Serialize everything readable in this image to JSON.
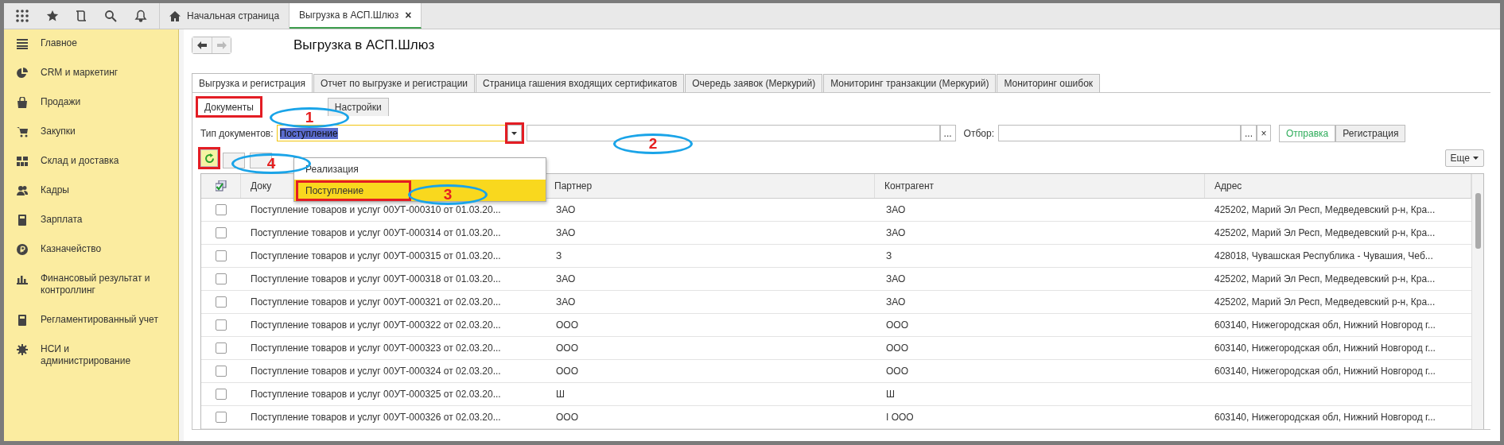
{
  "top_bar": {
    "tabs": [
      {
        "label": "Начальная страница",
        "selected": false
      },
      {
        "label": "Выгрузка в АСП.Шлюз",
        "selected": true,
        "close": "×"
      }
    ]
  },
  "sidebar": {
    "items": [
      {
        "label": "Главное"
      },
      {
        "label": "CRM и маркетинг"
      },
      {
        "label": "Продажи"
      },
      {
        "label": "Закупки"
      },
      {
        "label": "Склад и доставка"
      },
      {
        "label": "Кадры"
      },
      {
        "label": "Зарплата"
      },
      {
        "label": "Казначейство"
      },
      {
        "label": "Финансовый результат и контроллинг"
      },
      {
        "label": "Регламентированный учет"
      },
      {
        "label": "НСИ и администрирование"
      }
    ]
  },
  "page": {
    "title": "Выгрузка в АСП.Шлюз"
  },
  "tabs": [
    {
      "label": "Выгрузка и регистрация",
      "selected": true
    },
    {
      "label": "Отчет по выгрузке и регистрации",
      "selected": false
    },
    {
      "label": "Страница гашения входящих сертификатов",
      "selected": false
    },
    {
      "label": "Очередь заявок (Меркурий)",
      "selected": false
    },
    {
      "label": "Мониторинг транзакции (Меркурий)",
      "selected": false
    },
    {
      "label": "Мониторинг ошибок",
      "selected": false
    }
  ],
  "subtabs": [
    {
      "label": "Документы",
      "selected": true,
      "highlighted": true
    },
    {
      "label": "Настройки",
      "selected": false,
      "highlighted": false
    }
  ],
  "filter": {
    "label": "Тип документов:",
    "value": "Поступление",
    "arrow_highlighted": true,
    "select_button": "...",
    "filter_label": "Отбор:",
    "filter_select": "...",
    "filter_clear": "×"
  },
  "mode_buttons": [
    {
      "label": "Отправка",
      "selected": true
    },
    {
      "label": "Регистрация",
      "selected": false
    }
  ],
  "toolbar": {
    "refresh_highlighted": true,
    "more": "Еще"
  },
  "dropdown": {
    "options": [
      {
        "label": "Реализация",
        "selected": false,
        "highlighted": false
      },
      {
        "label": "Поступление",
        "selected": true,
        "highlighted": true
      }
    ]
  },
  "table": {
    "columns": [
      "Доку",
      "Партнер",
      "Контрагент",
      "Адрес"
    ],
    "rows": [
      {
        "checked": false,
        "document": "Поступление товаров и услуг 00УТ-000310 от 01.03.20...",
        "partner": "ЗАО",
        "counterparty": "ЗАО",
        "address": "425202, Марий Эл Респ, Медведевский р-н, Кра..."
      },
      {
        "checked": false,
        "document": "Поступление товаров и услуг 00УТ-000314 от 01.03.20...",
        "partner": "ЗАО",
        "counterparty": "ЗАО",
        "address": "425202, Марий Эл Респ, Медведевский р-н, Кра..."
      },
      {
        "checked": false,
        "document": "Поступление товаров и услуг 00УТ-000315 от 01.03.20...",
        "partner": "З",
        "counterparty": "З",
        "address": "428018, Чувашская Республика - Чувашия, Чеб..."
      },
      {
        "checked": false,
        "document": "Поступление товаров и услуг 00УТ-000318 от 01.03.20...",
        "partner": "ЗАО",
        "counterparty": "ЗАО",
        "address": "425202, Марий Эл Респ, Медведевский р-н, Кра..."
      },
      {
        "checked": false,
        "document": "Поступление товаров и услуг 00УТ-000321 от 02.03.20...",
        "partner": "ЗАО",
        "counterparty": "ЗАО",
        "address": "425202, Марий Эл Респ, Медведевский р-н, Кра..."
      },
      {
        "checked": false,
        "document": "Поступление товаров и услуг 00УТ-000322 от 02.03.20...",
        "partner": "ООО",
        "counterparty": "ООО",
        "address": "603140, Нижегородская обл, Нижний Новгород г..."
      },
      {
        "checked": false,
        "document": "Поступление товаров и услуг 00УТ-000323 от 02.03.20...",
        "partner": "ООО",
        "counterparty": "ООО",
        "address": "603140, Нижегородская обл, Нижний Новгород г..."
      },
      {
        "checked": false,
        "document": "Поступление товаров и услуг 00УТ-000324 от 02.03.20...",
        "partner": "ООО",
        "counterparty": "ООО",
        "address": "603140, Нижегородская обл, Нижний Новгород г..."
      },
      {
        "checked": false,
        "document": "Поступление товаров и услуг 00УТ-000325 от 02.03.20...",
        "partner": "Ш",
        "counterparty": "Ш"
      },
      {
        "checked": false,
        "document": "Поступление товаров и услуг 00УТ-000326 от 02.03.20...",
        "partner": "ООО",
        "counterparty": "I ООО",
        "address": "603140, Нижегородская обл, Нижний Новгород г..."
      }
    ]
  },
  "annotations": [
    {
      "label": "1"
    },
    {
      "label": "2"
    },
    {
      "label": "3"
    },
    {
      "label": "4"
    }
  ]
}
